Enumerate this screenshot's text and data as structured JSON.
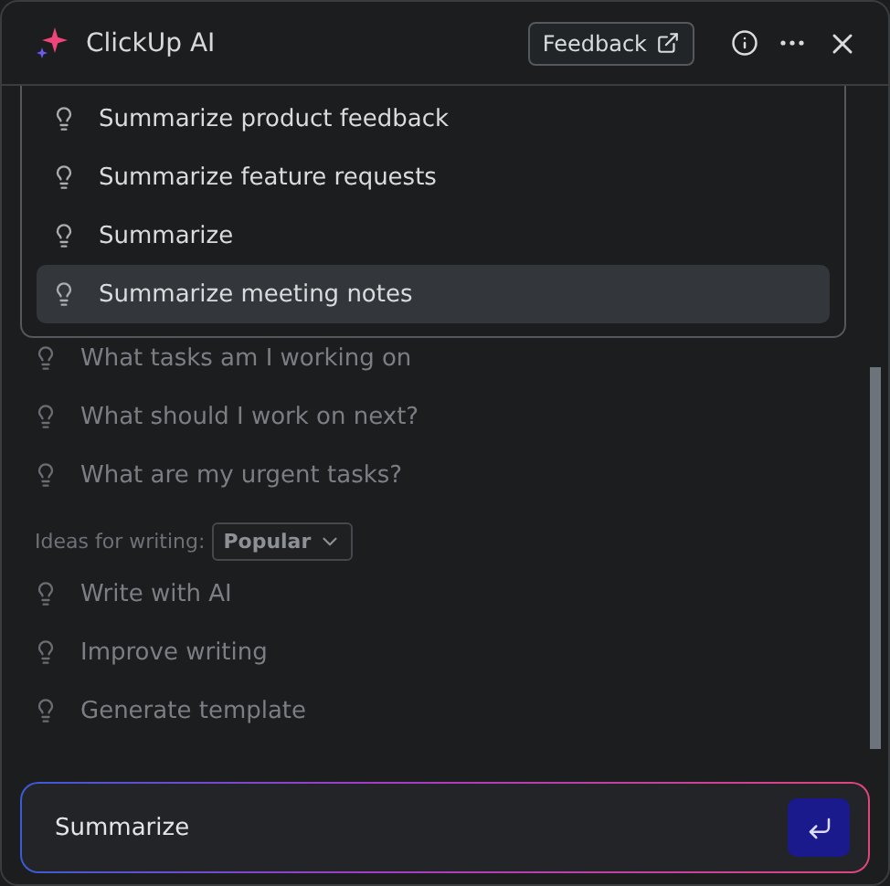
{
  "header": {
    "title": "ClickUp AI",
    "feedback_button": "Feedback"
  },
  "suggestions_dropdown": {
    "items": [
      {
        "label": "Summarize product feedback",
        "selected": false
      },
      {
        "label": "Summarize feature requests",
        "selected": false
      },
      {
        "label": "Summarize",
        "selected": false
      },
      {
        "label": "Summarize meeting notes",
        "selected": true
      }
    ]
  },
  "task_ideas": {
    "items": [
      "What tasks am I working on",
      "What should I work on next?",
      "What are my urgent tasks?"
    ]
  },
  "writing_ideas": {
    "label": "Ideas for writing:",
    "filter": "Popular",
    "items": [
      "Write with AI",
      "Improve writing",
      "Generate template"
    ]
  },
  "prompt_input": {
    "value": "Summarize"
  }
}
